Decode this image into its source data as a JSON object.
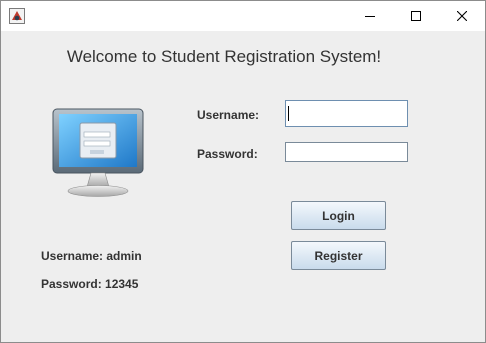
{
  "window": {
    "icon": "java-app-icon",
    "controls": [
      "minimize-icon",
      "maximize-icon",
      "close-icon"
    ]
  },
  "heading": "Welcome to Student Registration System!",
  "form": {
    "username_label": "Username:",
    "username_value": "",
    "password_label": "Password:",
    "password_value": ""
  },
  "buttons": {
    "login": "Login",
    "register": "Register"
  },
  "hints": {
    "username": "Username: admin",
    "password": "Password: 12345"
  },
  "colors": {
    "background": "#eeeeee",
    "button_top": "#f4f8fc",
    "button_bottom": "#c9dbec",
    "text": "#333333"
  }
}
